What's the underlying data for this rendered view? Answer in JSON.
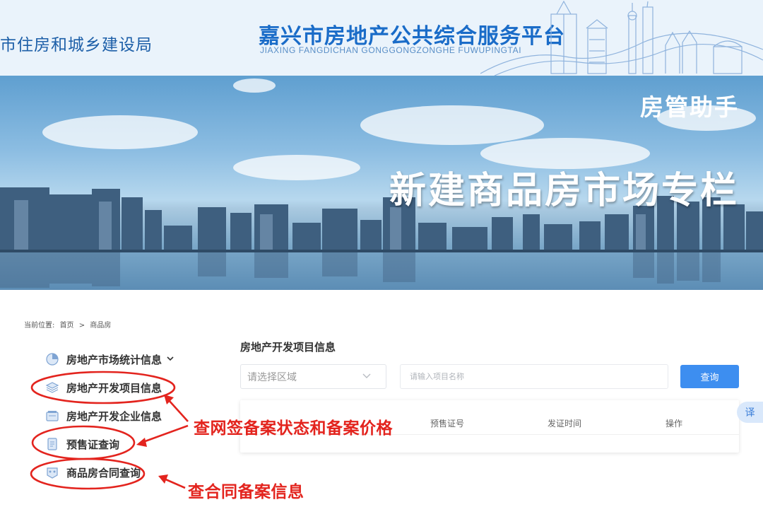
{
  "header": {
    "agency": "市住房和城乡建设局",
    "platform_title": "嘉兴市房地产公共综合服务平台",
    "platform_pinyin": "JIAXING FANGDICHAN GONGGONGZONGHE FUWUPINGTAI"
  },
  "banner": {
    "tag": "房管助手",
    "title": "新建商品房市场专栏"
  },
  "breadcrumb": {
    "label": "当前位置:",
    "home": "首页",
    "separator": ">",
    "current": "商品房"
  },
  "sidebar": {
    "items": [
      {
        "label": "房地产市场统计信息",
        "icon": "pie-chart-icon",
        "has_dropdown": true
      },
      {
        "label": "房地产开发项目信息",
        "icon": "layers-icon"
      },
      {
        "label": "房地产开发企业信息",
        "icon": "folder-card-icon"
      },
      {
        "label": "预售证查询",
        "icon": "document-icon"
      },
      {
        "label": "商品房合同查询",
        "icon": "contract-icon"
      }
    ]
  },
  "main": {
    "title": "房地产开发项目信息",
    "region_select": {
      "value": "请选择区域"
    },
    "project_search": {
      "placeholder": "请输入项目名称"
    },
    "query_button": "查询",
    "table": {
      "headers": [
        "预售证号",
        "发证时间",
        "操作"
      ]
    }
  },
  "translate_button": "译",
  "annotations": {
    "note_1": "查网签备案状态和备案价格",
    "note_2": "查合同备案信息",
    "color": "#e3241e"
  },
  "colors": {
    "brand_blue": "#1a6cc8",
    "button_blue": "#3d8ef0"
  }
}
